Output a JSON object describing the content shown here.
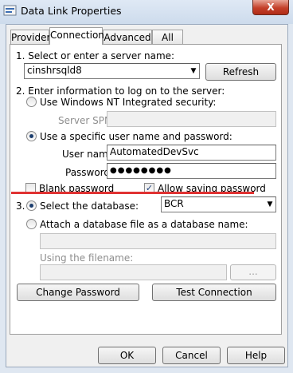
{
  "window": {
    "title": "Data Link Properties",
    "close_label": "X"
  },
  "tabs": [
    "Provider",
    "Connection",
    "Advanced",
    "All"
  ],
  "step1": {
    "label": "1. Select or enter a server name:",
    "server_value": "cinshrsqld8",
    "refresh_label": "Refresh"
  },
  "step2": {
    "label": "2. Enter information to log on to the server:",
    "windows_nt_label": "Use Windows NT Integrated security:",
    "spn_label": "Server SPN:",
    "specific_user_label": "Use a specific user name and password:",
    "username_label": "User name:",
    "username_value": "AutomatedDevSvc",
    "password_label": "Password:",
    "password_value": "●●●●●●●●",
    "blank_password_label": "Blank password",
    "blank_password_checked": false,
    "allow_saving_label": "Allow saving password",
    "allow_saving_checked": true
  },
  "step3": {
    "number": "3.",
    "select_db_label": "Select the database:",
    "database_value": "BCR",
    "attach_label": "Attach a database file as a database name:",
    "filename_label": "Using the filename:",
    "browse_label": "..."
  },
  "buttons": {
    "change_password": "Change Password",
    "test_connection": "Test Connection",
    "ok": "OK",
    "cancel": "Cancel",
    "help": "Help"
  },
  "colors": {
    "annotation_underline": "#e03232",
    "titlebar": "#d7e3f1"
  }
}
